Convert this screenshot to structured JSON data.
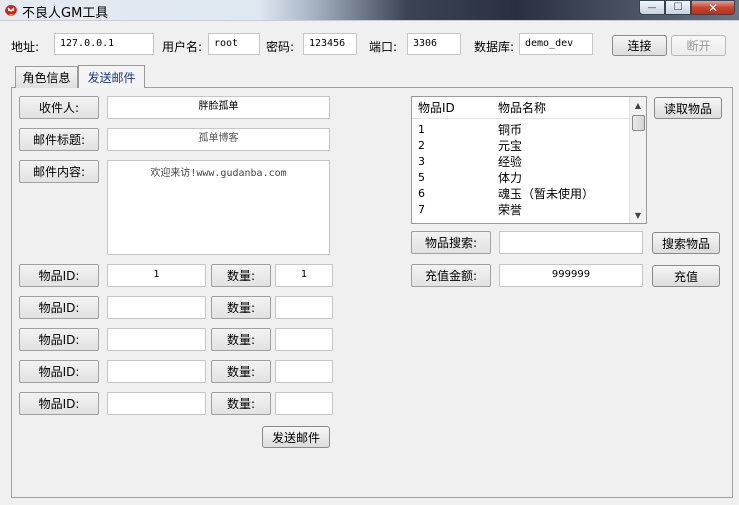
{
  "window": {
    "title": "不良人GM工具",
    "app_icon": "red-bird-icon",
    "minimize": "—",
    "maximize": "☐",
    "close": "✕"
  },
  "connection": {
    "address_label": "地址:",
    "address_value": "127.0.0.1",
    "username_label": "用户名:",
    "username_value": "root",
    "password_label": "密码:",
    "password_value": "123456",
    "port_label": "端口:",
    "port_value": "3306",
    "database_label": "数据库:",
    "database_value": "demo_dev",
    "connect_button": "连接",
    "disconnect_button": "断开"
  },
  "tabs": [
    {
      "label": "角色信息"
    },
    {
      "label": "发送邮件"
    }
  ],
  "mail": {
    "recipient_label": "收件人:",
    "recipient_value": "胖脸孤单",
    "subject_label": "邮件标题:",
    "subject_value": "孤单博客",
    "content_label": "邮件内容:",
    "content_value": "欢迎来访!www.gudanba.com",
    "item_id_label": "物品ID:",
    "quantity_label": "数量:",
    "items": [
      {
        "id": "1",
        "qty": "1"
      },
      {
        "id": "",
        "qty": ""
      },
      {
        "id": "",
        "qty": ""
      },
      {
        "id": "",
        "qty": ""
      },
      {
        "id": "",
        "qty": ""
      }
    ],
    "send_button": "发送邮件"
  },
  "item_list": {
    "col_id": "物品ID",
    "col_name": "物品名称",
    "rows": [
      {
        "id": "1",
        "name": "铜币"
      },
      {
        "id": "2",
        "name": "元宝"
      },
      {
        "id": "3",
        "name": "经验"
      },
      {
        "id": "5",
        "name": "体力"
      },
      {
        "id": "6",
        "name": "魂玉（暂未使用）"
      },
      {
        "id": "7",
        "name": "荣誉"
      }
    ],
    "scroll_up": "▲",
    "scroll_down": "▼",
    "read_button": "读取物品"
  },
  "search": {
    "label": "物品搜索:",
    "value": "",
    "button": "搜索物品"
  },
  "recharge": {
    "label": "充值金额:",
    "value": "999999",
    "button": "充值"
  }
}
